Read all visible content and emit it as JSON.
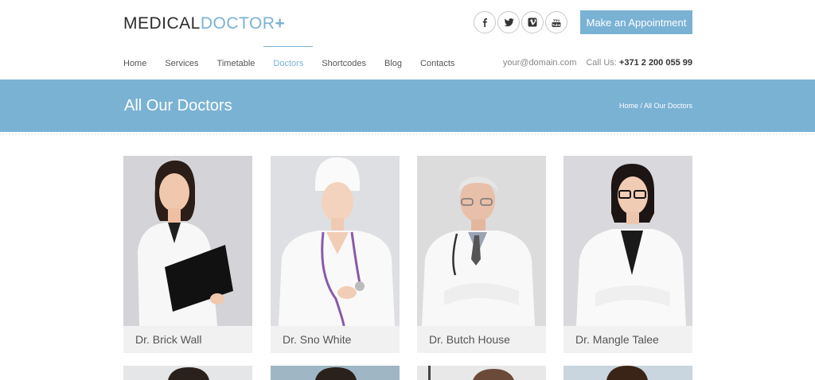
{
  "logo": {
    "part1": "MEDICAL",
    "part2": "DOCTOR",
    "plus": "+"
  },
  "socials": [
    {
      "icon": "facebook-icon",
      "glyph": "f"
    },
    {
      "icon": "twitter-icon"
    },
    {
      "icon": "vimeo-icon"
    },
    {
      "icon": "youtube-icon"
    }
  ],
  "header": {
    "appointment_label": "Make an Appointment"
  },
  "nav": {
    "items": [
      "Home",
      "Services",
      "Timetable",
      "Doctors",
      "Shortcodes",
      "Blog",
      "Contacts"
    ],
    "active": "Doctors"
  },
  "contact": {
    "email": "your@domain.com",
    "call_label": "Call Us:",
    "phone": "+371 2 200 055 99"
  },
  "banner": {
    "title": "All Our Doctors",
    "breadcrumb": "Home / All Our Doctors"
  },
  "doctors": [
    {
      "name": "Dr. Brick Wall"
    },
    {
      "name": "Dr. Sno White"
    },
    {
      "name": "Dr. Butch House"
    },
    {
      "name": "Dr. Mangle Talee"
    }
  ],
  "colors": {
    "accent": "#7ab2d4",
    "card_bg": "#f1f1f1",
    "text": "#555555"
  }
}
